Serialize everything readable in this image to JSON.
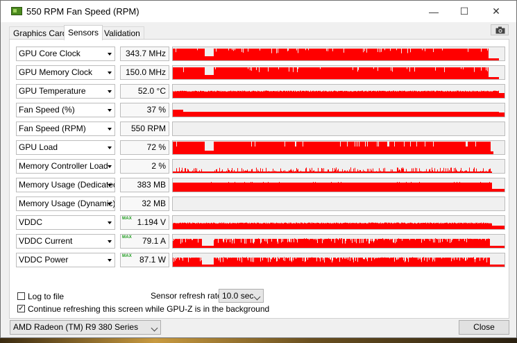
{
  "window": {
    "title": "550 RPM Fan Speed (RPM)",
    "controls": {
      "minimize": "—",
      "maximize": "☐",
      "close": "✕"
    }
  },
  "tabs": [
    {
      "label": "Graphics Card",
      "active": false
    },
    {
      "label": "Sensors",
      "active": true
    },
    {
      "label": "Validation",
      "active": false
    }
  ],
  "colors": {
    "graph": "#ff0000",
    "graph_bg": "#f0f0f0"
  },
  "sensors": [
    {
      "name": "GPU Core Clock",
      "value": "343.7 MHz",
      "max": false,
      "pattern": "clock"
    },
    {
      "name": "GPU Memory Clock",
      "value": "150.0 MHz",
      "max": false,
      "pattern": "clock"
    },
    {
      "name": "GPU Temperature",
      "value": "52.0 °C",
      "max": false,
      "pattern": "temp"
    },
    {
      "name": "Fan Speed (%)",
      "value": "37 %",
      "max": false,
      "pattern": "fanpct"
    },
    {
      "name": "Fan Speed (RPM)",
      "value": "550 RPM",
      "max": false,
      "pattern": "empty"
    },
    {
      "name": "GPU Load",
      "value": "72 %",
      "max": false,
      "pattern": "load"
    },
    {
      "name": "Memory Controller Load",
      "value": "2 %",
      "max": false,
      "pattern": "noise"
    },
    {
      "name": "Memory Usage (Dedicated)",
      "value": "383 MB",
      "max": false,
      "pattern": "memded"
    },
    {
      "name": "Memory Usage (Dynamic)",
      "value": "32 MB",
      "max": false,
      "pattern": "empty"
    },
    {
      "name": "VDDC",
      "value": "1.194 V",
      "max": true,
      "pattern": "vddc"
    },
    {
      "name": "VDDC Current",
      "value": "79.1 A",
      "max": true,
      "pattern": "power"
    },
    {
      "name": "VDDC Power",
      "value": "87.1 W",
      "max": true,
      "pattern": "power"
    }
  ],
  "max_tag": "MAX",
  "options": {
    "log_to_file": {
      "label": "Log to file",
      "checked": false
    },
    "continue_refresh": {
      "label": "Continue refreshing this screen while GPU-Z is in the background",
      "checked": true,
      "mark": "✓"
    }
  },
  "refresh": {
    "label": "Sensor refresh rate:",
    "value": "10.0 sec"
  },
  "gpu_select": {
    "value": "AMD Radeon (TM) R9 380 Series"
  },
  "close_button": {
    "label": "Close"
  },
  "icons": {
    "app": "gpu-z-icon",
    "camera": "camera-icon"
  }
}
